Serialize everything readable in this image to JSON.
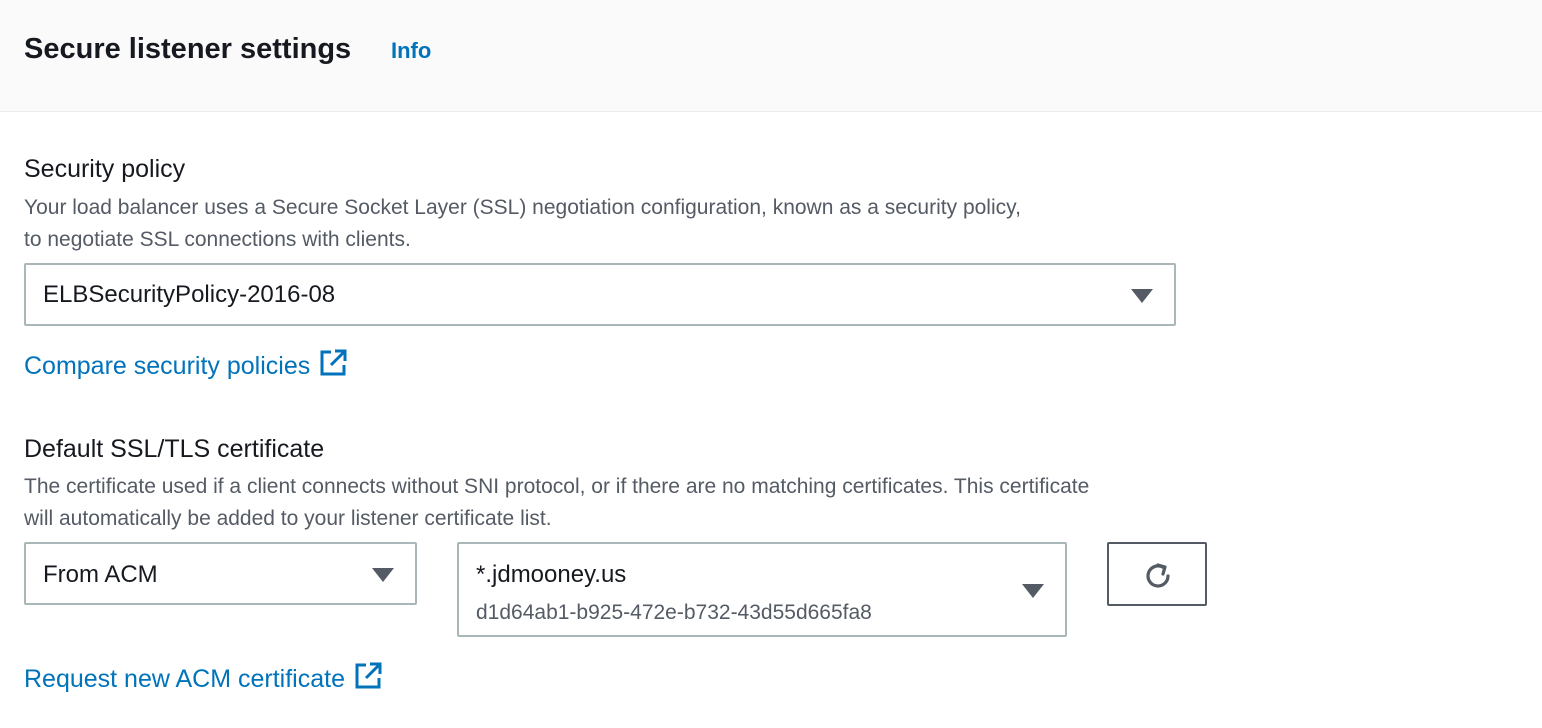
{
  "header": {
    "title": "Secure listener settings",
    "info_label": "Info"
  },
  "security_policy": {
    "label": "Security policy",
    "description_line1": "Your load balancer uses a Secure Socket Layer (SSL) negotiation configuration, known as a security policy,",
    "description_line2": "to negotiate SSL connections with clients.",
    "selected": "ELBSecurityPolicy-2016-08",
    "compare_link": "Compare security policies"
  },
  "certificate": {
    "label": "Default SSL/TLS certificate",
    "description_line1": "The certificate used if a client connects without SNI protocol, or if there are no matching certificates. This certificate",
    "description_line2": "will automatically be added to your listener certificate list.",
    "source_selected": "From ACM",
    "cert_name": "*.jdmooney.us",
    "cert_id": "d1d64ab1-b925-472e-b732-43d55d665fa8",
    "request_link": "Request new ACM certificate"
  },
  "icons": {
    "caret": "caret-down-icon",
    "external": "external-link-icon",
    "refresh": "refresh-icon"
  },
  "colors": {
    "link": "#0073bb",
    "text": "#16191f",
    "secondary_text": "#545b64",
    "border": "#aab7b8",
    "header_bg": "#fafafa"
  }
}
